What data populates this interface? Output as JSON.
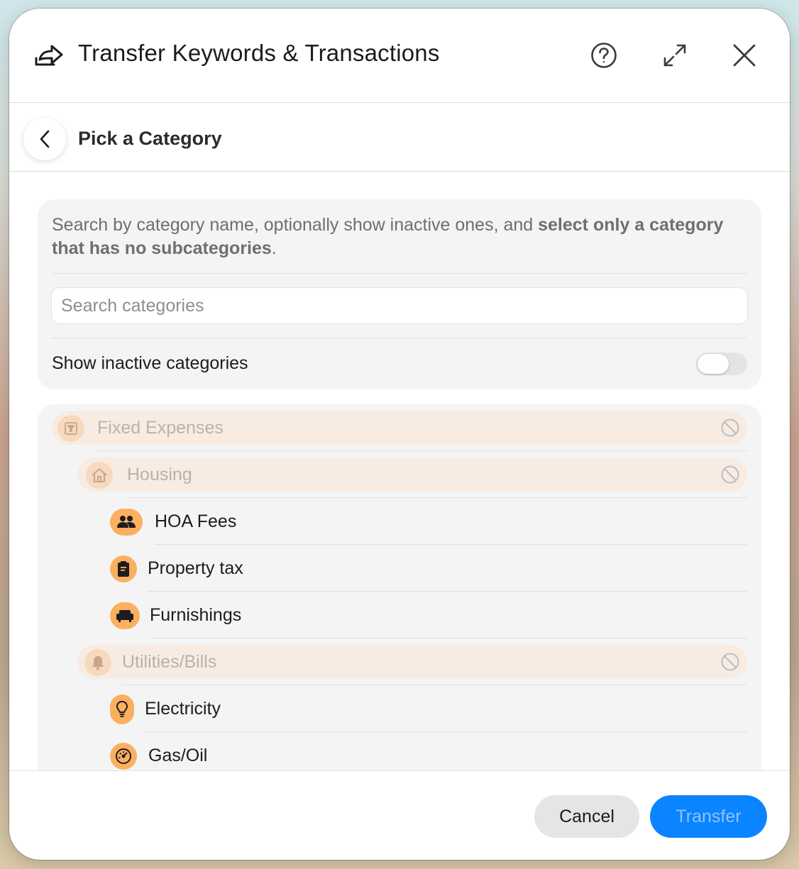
{
  "dialog": {
    "title": "Transfer Keywords & Transactions",
    "title_icon": "share-forward-icon",
    "help_icon": "question-circle-icon",
    "expand_icon": "expand-arrows-icon",
    "close_icon": "close-icon"
  },
  "subheader": {
    "back_icon": "chevron-left-icon",
    "title": "Pick a Category"
  },
  "search_card": {
    "description_prefix": "Search by category name, optionally show inactive ones, and ",
    "description_bold": "select only a category that has no subcategories",
    "description_suffix": ".",
    "search_placeholder": "Search categories",
    "search_value": "",
    "toggle_label": "Show inactive categories",
    "toggle_on": false
  },
  "categories": [
    {
      "label": "Fixed Expenses",
      "icon": "pin-box-icon",
      "selectable": false
    },
    {
      "label": "Housing",
      "icon": "house-icon",
      "selectable": false
    },
    {
      "label": "HOA Fees",
      "icon": "people-icon",
      "selectable": true
    },
    {
      "label": "Property tax",
      "icon": "clipboard-icon",
      "selectable": true
    },
    {
      "label": "Furnishings",
      "icon": "sofa-icon",
      "selectable": true
    },
    {
      "label": "Utilities/Bills",
      "icon": "bell-icon",
      "selectable": false
    },
    {
      "label": "Electricity",
      "icon": "lightbulb-icon",
      "selectable": true
    },
    {
      "label": "Gas/Oil",
      "icon": "gauge-icon",
      "selectable": true
    }
  ],
  "footer": {
    "cancel_label": "Cancel",
    "transfer_label": "Transfer"
  },
  "colors": {
    "accent": "#0a84ff",
    "category_icon": "#fbb060",
    "disabled_row_bg": "#f8ece2"
  }
}
